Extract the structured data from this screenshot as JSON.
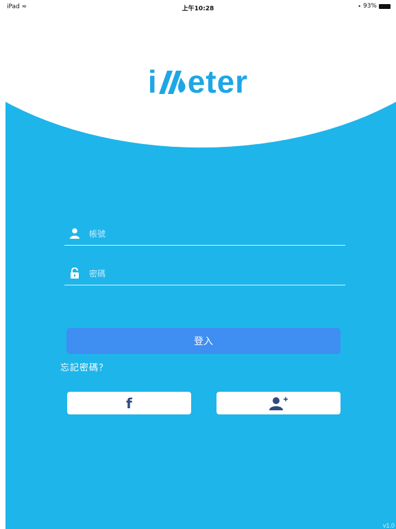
{
  "status_bar": {
    "device": "iPad",
    "time": "上午10:28",
    "battery": "93%"
  },
  "logo": {
    "text_prefix": "i",
    "text_suffix": "eter",
    "color": "#1ea6e6"
  },
  "form": {
    "account_placeholder": "帳號",
    "password_placeholder": "密碼",
    "account_icon": "user-icon",
    "password_icon": "lock-icon"
  },
  "actions": {
    "login_label": "登入",
    "forgot_password": "忘記密碼？",
    "facebook_glyph": "f",
    "register_icon": "add-user-icon"
  },
  "version": "v1.0",
  "colors": {
    "background": "#1eb5ea",
    "login_button": "#3f8ef2",
    "facebook_blue": "#2d4a82"
  }
}
